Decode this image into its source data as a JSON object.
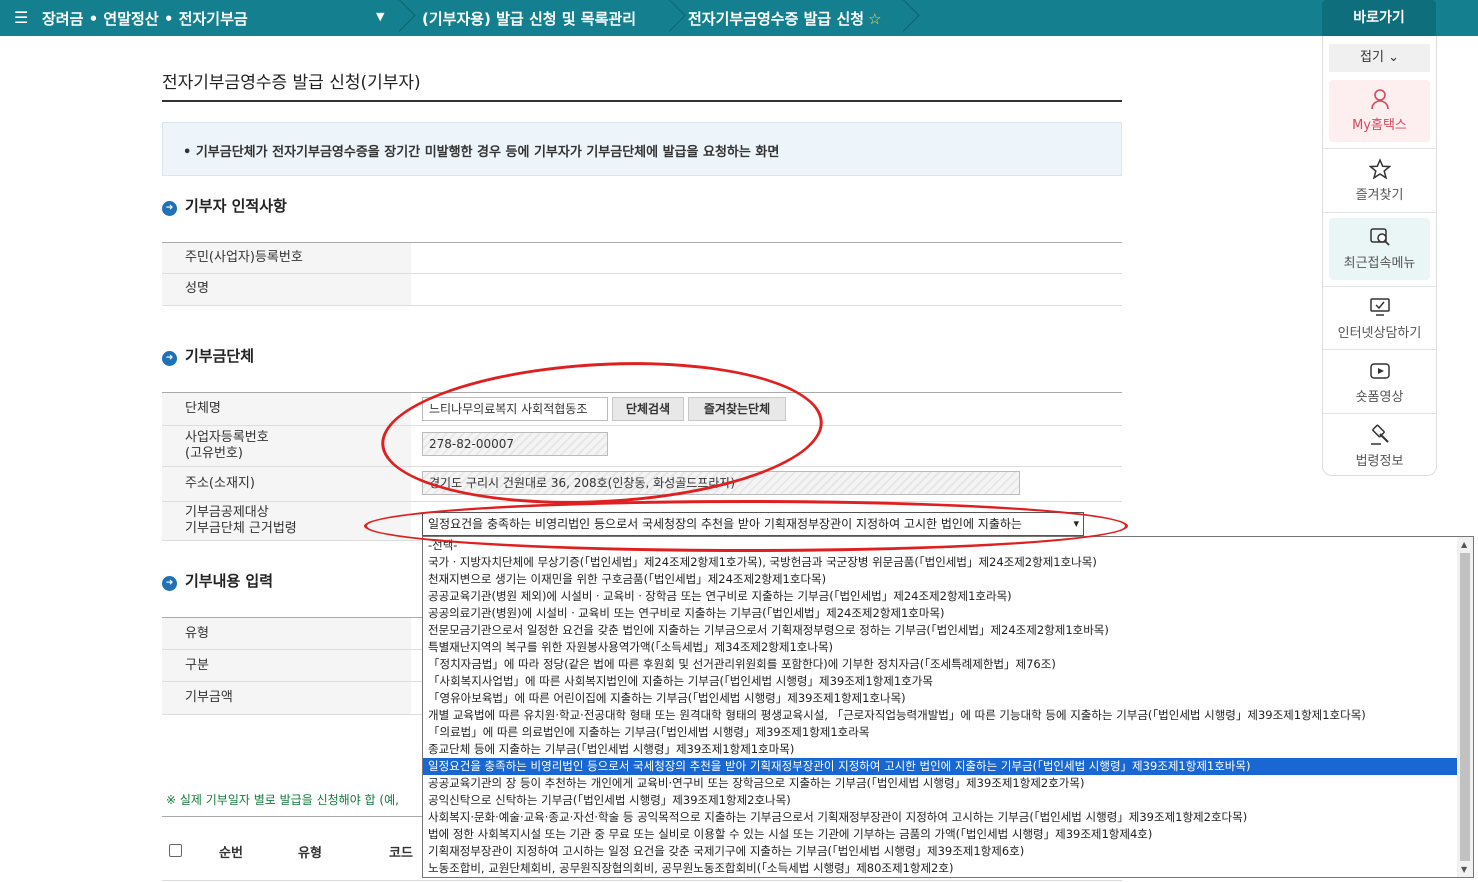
{
  "topbar": {
    "menu_icon": "☰",
    "crumb1": "장려금 • 연말정산 • 전자기부금",
    "crumb2": "(기부자용) 발급 신청 및 목록관리",
    "crumb3": "전자기부금영수증 발급 신청",
    "quick_title": "바로가기"
  },
  "quick": {
    "fold": "접기",
    "items": [
      "My홈택스",
      "즐겨찾기",
      "최근접속메뉴",
      "인터넷상담하기",
      "숏폼영상",
      "법령정보"
    ]
  },
  "page": {
    "title": "전자기부금영수증 발급 신청(기부자)",
    "notice": "• 기부금단체가 전자기부금영수증을 장기간 미발행한 경우 등에 기부자가 기부금단체에 발급을 요청하는 화면"
  },
  "donor": {
    "section": "기부자 인적사항",
    "rrn_label": "주민(사업자)등록번호",
    "name_label": "성명"
  },
  "org": {
    "section": "기부금단체",
    "name_label": "단체명",
    "name_value": "느티나무의료복지 사회적협동조",
    "search_btn": "단체검색",
    "fav_btn": "즐겨찾는단체",
    "bizno_label1": "사업자등록번호",
    "bizno_label2": "(고유번호)",
    "bizno_value": "278-82-00007",
    "addr_label": "주소(소재지)",
    "addr_value": "경기도 구리시 건원대로 36, 208호(인창동, 화성골드프라자)",
    "law_label1": "기부금공제대상",
    "law_label2": "기부금단체 근거법령",
    "law_selected": "일정요건을 충족하는 비영리법인 등으로서 국세청장의 추천을 받아 기획재정부장관이 지정하여 고시한 법인에 지출하는"
  },
  "detail": {
    "section": "기부내용 입력",
    "type_label": "유형",
    "kind_label": "구분",
    "amount_label": "기부금액",
    "note": "※ 실제 기부일자 별로 발급을 신청해야 합 (예,",
    "cols": [
      "순번",
      "유형",
      "코드"
    ]
  },
  "dropdown_options": [
    "-선택-",
    "국가ㆍ지방자치단체에 무상기증(「법인세법」제24조제2항제1호가목), 국방헌금과 국군장병 위문금품(「법인세법」제24조제2항제1호나목)",
    "천재지변으로 생기는 이재민을 위한 구호금품(「법인세법」제24조제2항제1호다목)",
    "공공교육기관(병원 제외)에 시설비ㆍ교육비ㆍ장학금 또는 연구비로 지출하는 기부금(「법인세법」제24조제2항제1호라목)",
    "공공의료기관(병원)에 시설비ㆍ교육비 또는 연구비로 지출하는 기부금(「법인세법」제24조제2항제1호마목)",
    "전문모금기관으로서 일정한 요건을 갖춘 법인에 지출하는 기부금으로서 기획재정부령으로 정하는 기부금(「법인세법」제24조제2항제1호바목)",
    "특별재난지역의 복구를 위한 자원봉사용역가액(「소득세법」제34조제2항제1호나목)",
    "「정치자금법」에 따라 정당(같은 법에 따른 후원회 및 선거관리위원회를 포함한다)에 기부한 정치자금(「조세특례제한법」제76조)",
    "「사회복지사업법」에 따른 사회복지법인에 지출하는 기부금(「법인세법 시행령」제39조제1항제1호가목",
    "「영유아보육법」에 따른 어린이집에 지출하는 기부금(「법인세법 시행령」제39조제1항제1호나목)",
    "개별 교육법에 따른 유치원·학교·전공대학 형태 또는 원격대학 형태의 평생교육시설, 「근로자직업능력개발법」에 따른 기능대학 등에 지출하는 기부금(「법인세법 시행령」제39조제1항제1호다목)",
    "「의료법」에 따른 의료법인에 지출하는 기부금(「법인세법 시행령」제39조제1항제1호라목",
    "종교단체 등에 지출하는 기부금(「법인세법 시행령」제39조제1항제1호마목)",
    "일정요건을 충족하는 비영리법인 등으로서 국세청장의 추천을 받아 기획재정부장관이 지정하여 고시한 법인에 지출하는 기부금(「법인세법 시행령」제39조제1항제1호바목)",
    "공공교육기관의 장 등이 추천하는 개인에게 교육비·연구비 또는 장학금으로 지출하는 기부금(「법인세법 시행령」제39조제1항제2호가목)",
    "공익신탁으로 신탁하는 기부금(「법인세법 시행령」제39조제1항제2호나목)",
    "사회복지·문화·예술·교육·종교·자선·학술 등 공익목적으로 지출하는 기부금으로서 기획재정부장관이 지정하여 고시하는 기부금(「법인세법 시행령」제39조제1항제2호다목)",
    "법에 정한 사회복지시설 또는 기관 중 무료 또는 실비로 이용할 수 있는 시설 또는 기관에 기부하는 금품의 가액(「법인세법 시행령」제39조제1항제4호)",
    "기획재정부장관이 지정하여 고시하는 일정 요건을 갖춘 국제기구에 지출하는 기부금(「법인세법 시행령」제39조제1항제6호)",
    "노동조합비, 교원단체회비, 공무원직장협의회비, 공무원노동조합회비(「소득세법 시행령」제80조제1항제2호)"
  ],
  "selected_index": 13
}
